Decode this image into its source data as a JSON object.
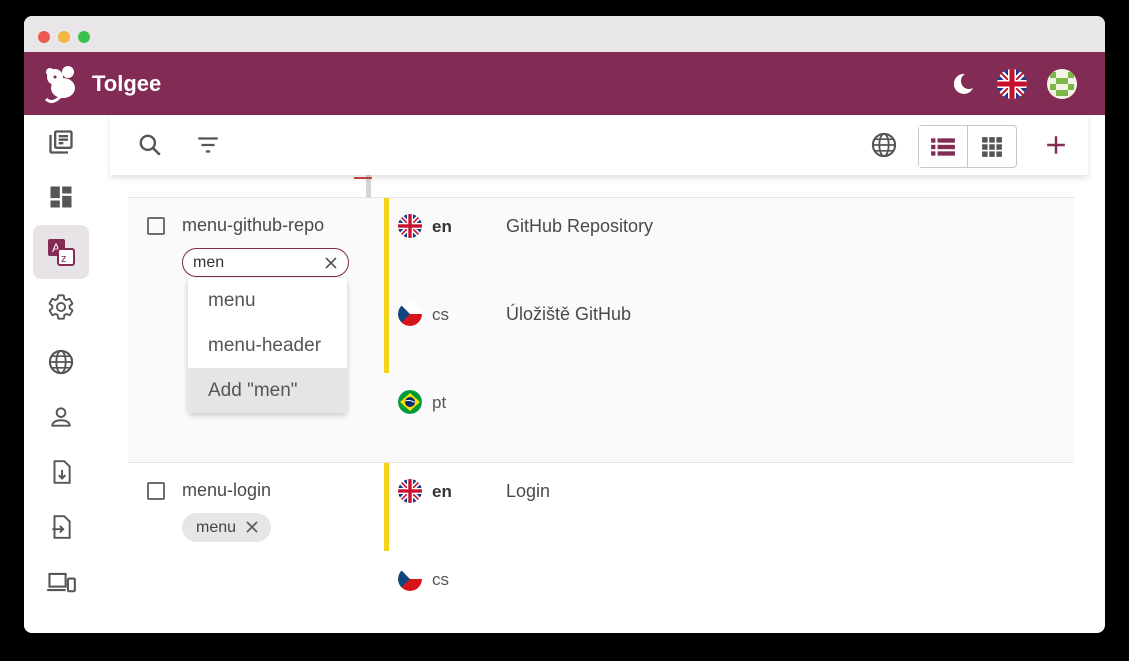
{
  "app": {
    "brand": "Tolgee"
  },
  "colors": {
    "primary": "#822b55",
    "state_reviewed": "#f5d31a",
    "divider": "#d4d4d4"
  },
  "header": {
    "icons": [
      "moon-icon",
      "uk-flag-icon",
      "user-avatar"
    ]
  },
  "sidebar": {
    "items": [
      "projects-icon",
      "dashboard-icon",
      "translations-icon",
      "settings-icon",
      "languages-icon",
      "members-icon",
      "import-icon",
      "export-icon",
      "integrate-icon"
    ],
    "active": "translations-icon"
  },
  "toolbar": {
    "icons": [
      "search-icon",
      "filter-icon",
      "languages-icon",
      "list-view-icon",
      "grid-view-icon",
      "add-icon"
    ],
    "view": "list"
  },
  "rows": [
    {
      "key": "menu-github-repo",
      "tag_input": {
        "value": "men"
      },
      "dropdown": {
        "options": [
          "menu",
          "menu-header",
          "Add \"men\""
        ],
        "highlighted": 2
      },
      "translations": [
        {
          "lang": "en",
          "text": "GitHub Repository",
          "base": true
        },
        {
          "lang": "cs",
          "text": "Úložiště GitHub",
          "base": false
        },
        {
          "lang": "pt",
          "text": "",
          "base": false
        }
      ]
    },
    {
      "key": "menu-login",
      "tags": [
        "menu"
      ],
      "translations": [
        {
          "lang": "en",
          "text": "Login",
          "base": true
        },
        {
          "lang": "cs",
          "text": "",
          "base": false
        }
      ]
    }
  ]
}
